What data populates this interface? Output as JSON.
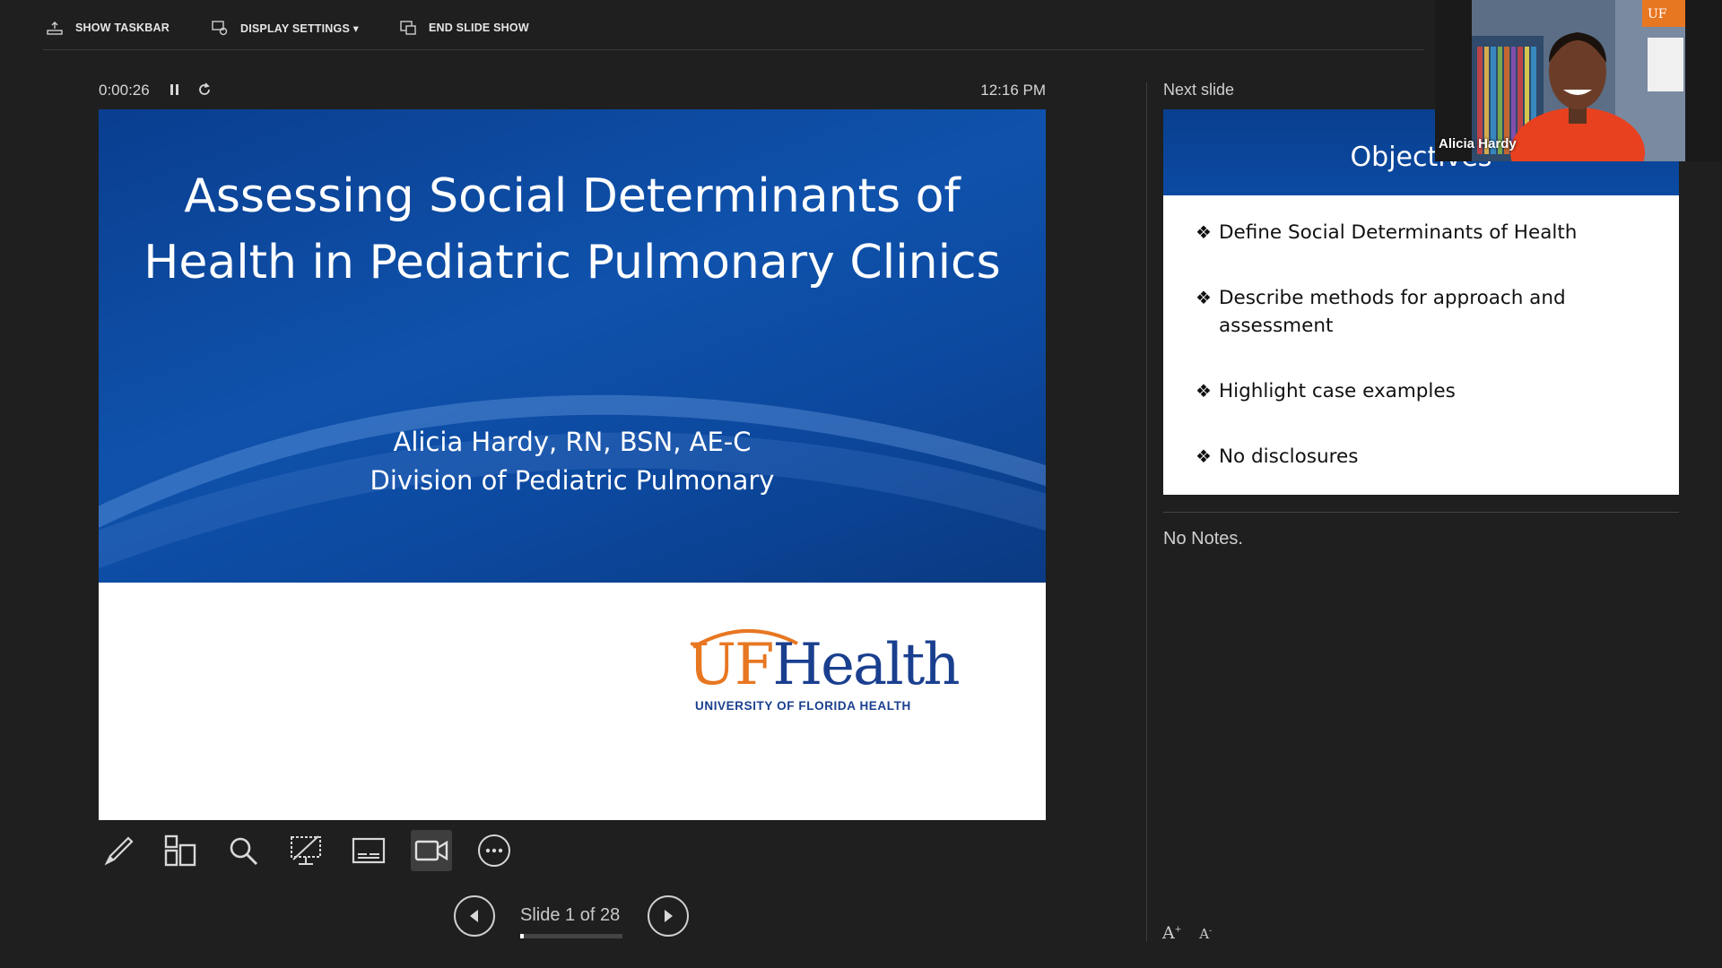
{
  "toolbar": {
    "show_taskbar": "SHOW TASKBAR",
    "display_settings": "DISPLAY SETTINGS ▾",
    "end_slide_show": "END SLIDE SHOW"
  },
  "presenter": {
    "timer": "0:00:26",
    "clock": "12:16 PM"
  },
  "current_slide": {
    "title": "Assessing Social Determinants of Health in Pediatric Pulmonary Clinics",
    "author_line1": "Alicia Hardy, RN, BSN, AE-C",
    "author_line2": "Division of Pediatric Pulmonary",
    "logo_uf": "UF",
    "logo_health": "Health",
    "logo_subtitle": "UNIVERSITY OF FLORIDA HEALTH"
  },
  "tools": [
    {
      "icon": "pen-icon"
    },
    {
      "icon": "see-all-slides-icon"
    },
    {
      "icon": "zoom-icon"
    },
    {
      "icon": "black-screen-icon"
    },
    {
      "icon": "subtitles-icon"
    },
    {
      "icon": "camera-icon"
    },
    {
      "icon": "more-options-icon"
    }
  ],
  "navigation": {
    "slide_counter": "Slide 1 of 28",
    "current": 1,
    "total": 28
  },
  "next_slide": {
    "label": "Next slide",
    "title": "Objectives",
    "bullets": [
      "Define Social Determinants of Health",
      "Describe methods for approach and assessment",
      "Highlight case examples",
      "No disclosures"
    ]
  },
  "notes": {
    "text": "No Notes."
  },
  "webcam": {
    "name": "Alicia Hardy"
  },
  "colors": {
    "background": "#1f1f1f",
    "slide_blue": "#0f52ac",
    "uf_orange": "#e87722",
    "uf_blue": "#1a3f8f"
  }
}
